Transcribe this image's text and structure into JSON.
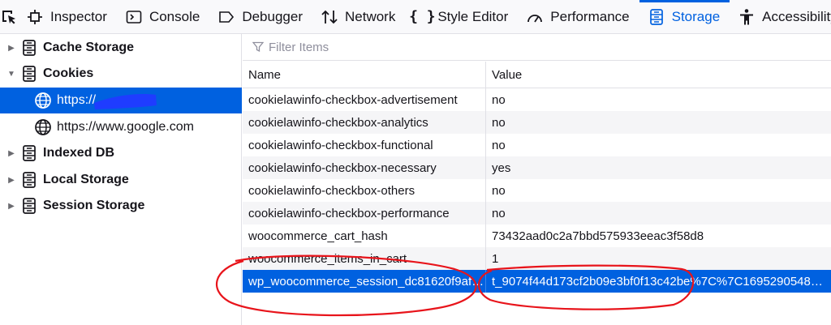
{
  "toolbar": {
    "tabs": [
      {
        "label": "Inspector",
        "icon": "inspector-icon"
      },
      {
        "label": "Console",
        "icon": "console-icon"
      },
      {
        "label": "Debugger",
        "icon": "debugger-icon"
      },
      {
        "label": "Network",
        "icon": "network-icon"
      },
      {
        "label": "Style Editor",
        "icon": "style-editor-icon"
      },
      {
        "label": "Performance",
        "icon": "performance-icon"
      },
      {
        "label": "Storage",
        "icon": "storage-icon",
        "selected": true
      },
      {
        "label": "Accessibility",
        "icon": "accessibility-icon"
      }
    ]
  },
  "sidebar": {
    "items": [
      {
        "label": "Cache Storage",
        "type": "group",
        "expanded": false
      },
      {
        "label": "Cookies",
        "type": "group",
        "expanded": true
      },
      {
        "label": "https://",
        "type": "host",
        "selected": true
      },
      {
        "label": "https://www.google.com",
        "type": "host"
      },
      {
        "label": "Indexed DB",
        "type": "group",
        "expanded": false
      },
      {
        "label": "Local Storage",
        "type": "group",
        "expanded": false
      },
      {
        "label": "Session Storage",
        "type": "group",
        "expanded": false
      }
    ]
  },
  "filter": {
    "placeholder": "Filter Items"
  },
  "table": {
    "headers": {
      "name": "Name",
      "value": "Value"
    },
    "rows": [
      {
        "name": "cookielawinfo-checkbox-advertisement",
        "value": "no"
      },
      {
        "name": "cookielawinfo-checkbox-analytics",
        "value": "no"
      },
      {
        "name": "cookielawinfo-checkbox-functional",
        "value": "no"
      },
      {
        "name": "cookielawinfo-checkbox-necessary",
        "value": "yes"
      },
      {
        "name": "cookielawinfo-checkbox-others",
        "value": "no"
      },
      {
        "name": "cookielawinfo-checkbox-performance",
        "value": "no"
      },
      {
        "name": "woocommerce_cart_hash",
        "value": "73432aad0c2a7bbd575933eeac3f58d8"
      },
      {
        "name": "woocommerce_items_in_cart",
        "value": "1"
      },
      {
        "name": "wp_woocommerce_session_dc81620f9af8...",
        "value": "t_9074f44d173cf2b09e3bf0f13c42be%7C%7C1695290548%7...",
        "selected": true
      }
    ]
  },
  "colors": {
    "accent": "#0061e0",
    "annotation": "#e8141b"
  }
}
